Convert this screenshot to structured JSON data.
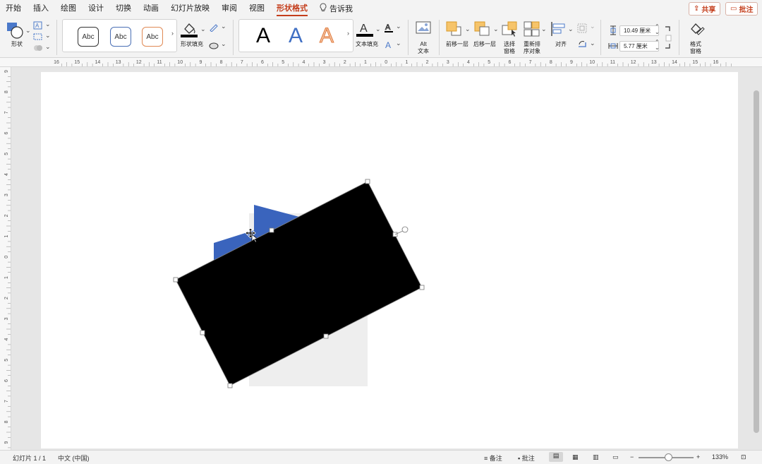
{
  "menu": {
    "items": [
      "开始",
      "插入",
      "绘图",
      "设计",
      "切换",
      "动画",
      "幻灯片放映",
      "审阅",
      "视图"
    ],
    "active_tab": "形状格式",
    "tell_me": "告诉我"
  },
  "top_buttons": {
    "share": "共享",
    "comments": "批注"
  },
  "ribbon": {
    "shapes_label": "形状",
    "shape_styles": [
      "Abc",
      "Abc",
      "Abc"
    ],
    "shape_fill_label": "形状填充",
    "wordart_styles": [
      "A",
      "A",
      "A"
    ],
    "text_fill_label": "文本填充",
    "alt_text_label_1": "Alt",
    "alt_text_label_2": "文本",
    "bring_forward_label": "前移一层",
    "send_backward_label": "后移一层",
    "selection_pane_label_1": "选择",
    "selection_pane_label_2": "窗格",
    "reorder_label_1": "重新排",
    "reorder_label_2": "序对象",
    "align_label": "对齐",
    "height_value": "10.49 厘米",
    "width_value": "5.77 厘米",
    "format_pane_label_1": "格式",
    "format_pane_label_2": "窗格"
  },
  "ruler": {
    "h_ticks": [
      "16",
      "15",
      "14",
      "13",
      "12",
      "11",
      "10",
      "9",
      "8",
      "7",
      "6",
      "5",
      "4",
      "3",
      "2",
      "1",
      "0",
      "1",
      "2",
      "3",
      "4",
      "5",
      "6",
      "7",
      "8",
      "9",
      "10",
      "11",
      "12",
      "13",
      "14",
      "15",
      "16"
    ],
    "v_ticks": [
      "9",
      "8",
      "7",
      "6",
      "5",
      "4",
      "3",
      "2",
      "1",
      "0",
      "1",
      "2",
      "3",
      "4",
      "5",
      "6",
      "7",
      "8",
      "9"
    ]
  },
  "colors": {
    "accent": "#c43e1c",
    "arrow_blue": "#3a64bd",
    "rect_black": "#000000",
    "ghost_gray": "#eeeeee"
  },
  "status": {
    "slide_info": "幻灯片 1 / 1",
    "language": "中文 (中国)",
    "notes_label": "备注",
    "comments_label": "批注",
    "zoom": "133%"
  }
}
